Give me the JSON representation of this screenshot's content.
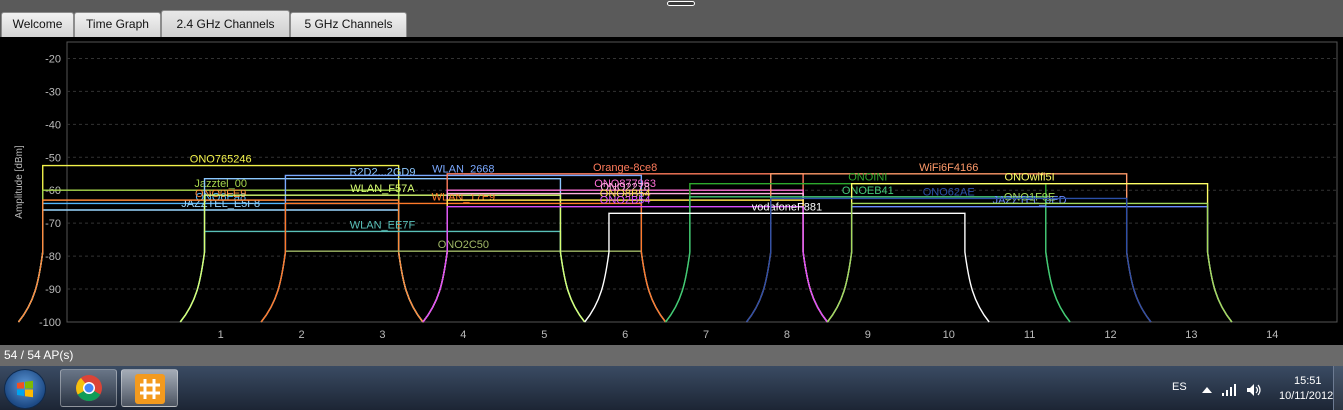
{
  "tabs": [
    {
      "label": "Welcome",
      "active": false
    },
    {
      "label": "Time Graph",
      "active": false
    },
    {
      "label": "2.4 GHz Channels",
      "active": true
    },
    {
      "label": "5 GHz Channels",
      "active": false
    }
  ],
  "chart_data": {
    "type": "area",
    "ylabel": "Amplitude [dBm]",
    "ylim": [
      -100,
      -15
    ],
    "y_ticks": [
      "-20",
      "-30",
      "-40",
      "-50",
      "-60",
      "-70",
      "-80",
      "-90",
      "-100"
    ],
    "x_ticks": [
      "1",
      "2",
      "3",
      "4",
      "5",
      "6",
      "7",
      "8",
      "9",
      "10",
      "11",
      "12",
      "13",
      "14"
    ],
    "xlim": [
      -0.9,
      14.8
    ],
    "grid": true,
    "networks": [
      {
        "name": "ONO765246",
        "channel": 1,
        "amplitude": -52.5,
        "color": "#f2f24a"
      },
      {
        "name": "Jazztel_00",
        "channel": 1,
        "amplitude": -60,
        "color": "#a6d64c"
      },
      {
        "name": "ONO6Ea8",
        "channel": 1,
        "amplitude": -64,
        "color": "#54b8ff"
      },
      {
        "name": "JAZZTEL_E5F8",
        "channel": 1,
        "amplitude": -66,
        "color": "#9ad7ff"
      },
      {
        "name": "ONO0FE9",
        "channel": 1,
        "amplitude": -63,
        "color": "#ff8a3a"
      },
      {
        "name": "R2D2...2GD9",
        "channel": 3,
        "amplitude": -56.5,
        "color": "#8cc8ff"
      },
      {
        "name": "ONO2C50",
        "channel": 4,
        "amplitude": -78.5,
        "color": "#a0b866"
      },
      {
        "name": "WLAN_2668",
        "channel": 4,
        "amplitude": -55.5,
        "color": "#7aa8ff"
      },
      {
        "name": "WLAN_EE7F",
        "channel": 3,
        "amplitude": -72.5,
        "color": "#59c0b8"
      },
      {
        "name": "WLAN_F57A",
        "channel": 3,
        "amplitude": -61.5,
        "color": "#d8ff73"
      },
      {
        "name": "WLAN_17E9",
        "channel": 4,
        "amplitude": -64,
        "color": "#ff7a2a"
      },
      {
        "name": "Orange-8ce8",
        "channel": 6,
        "amplitude": -55,
        "color": "#ff7b5b"
      },
      {
        "name": "ONO877963",
        "channel": 6,
        "amplitude": -60,
        "color": "#ff70d8"
      },
      {
        "name": "ONO2278",
        "channel": 6,
        "amplitude": -61,
        "color": "#ffb0e0"
      },
      {
        "name": "ONO8B54",
        "channel": 6,
        "amplitude": -63,
        "color": "#ffe04a"
      },
      {
        "name": "ONO2B54",
        "channel": 6,
        "amplitude": -65,
        "color": "#d84dff"
      },
      {
        "name": "WiFi6F4166",
        "channel": 10,
        "amplitude": -55,
        "color": "#ff9a6a"
      },
      {
        "name": "ONOINI",
        "channel": 9,
        "amplitude": -58,
        "color": "#2eaa2e"
      },
      {
        "name": "ONOEB41",
        "channel": 9,
        "amplitude": -62,
        "color": "#44c878"
      },
      {
        "name": "vodafoneF881",
        "channel": 8,
        "amplitude": -67,
        "color": "#ffffff"
      },
      {
        "name": "ONOwifi5I",
        "channel": 11,
        "amplitude": -58,
        "color": "#ffff66"
      },
      {
        "name": "JAZZTEL_9ED",
        "channel": 11,
        "amplitude": -65,
        "color": "#6a8cff"
      },
      {
        "name": "ONO1F9E",
        "channel": 11,
        "amplitude": -64,
        "color": "#a5d95a"
      },
      {
        "name": "ONO62AE",
        "channel": 10,
        "amplitude": -62.5,
        "color": "#2b4fa8"
      }
    ]
  },
  "status": {
    "ap_count": "54 / 54 AP(s)"
  },
  "taskbar": {
    "language": "ES",
    "time": "15:51",
    "date": "10/11/2012"
  }
}
